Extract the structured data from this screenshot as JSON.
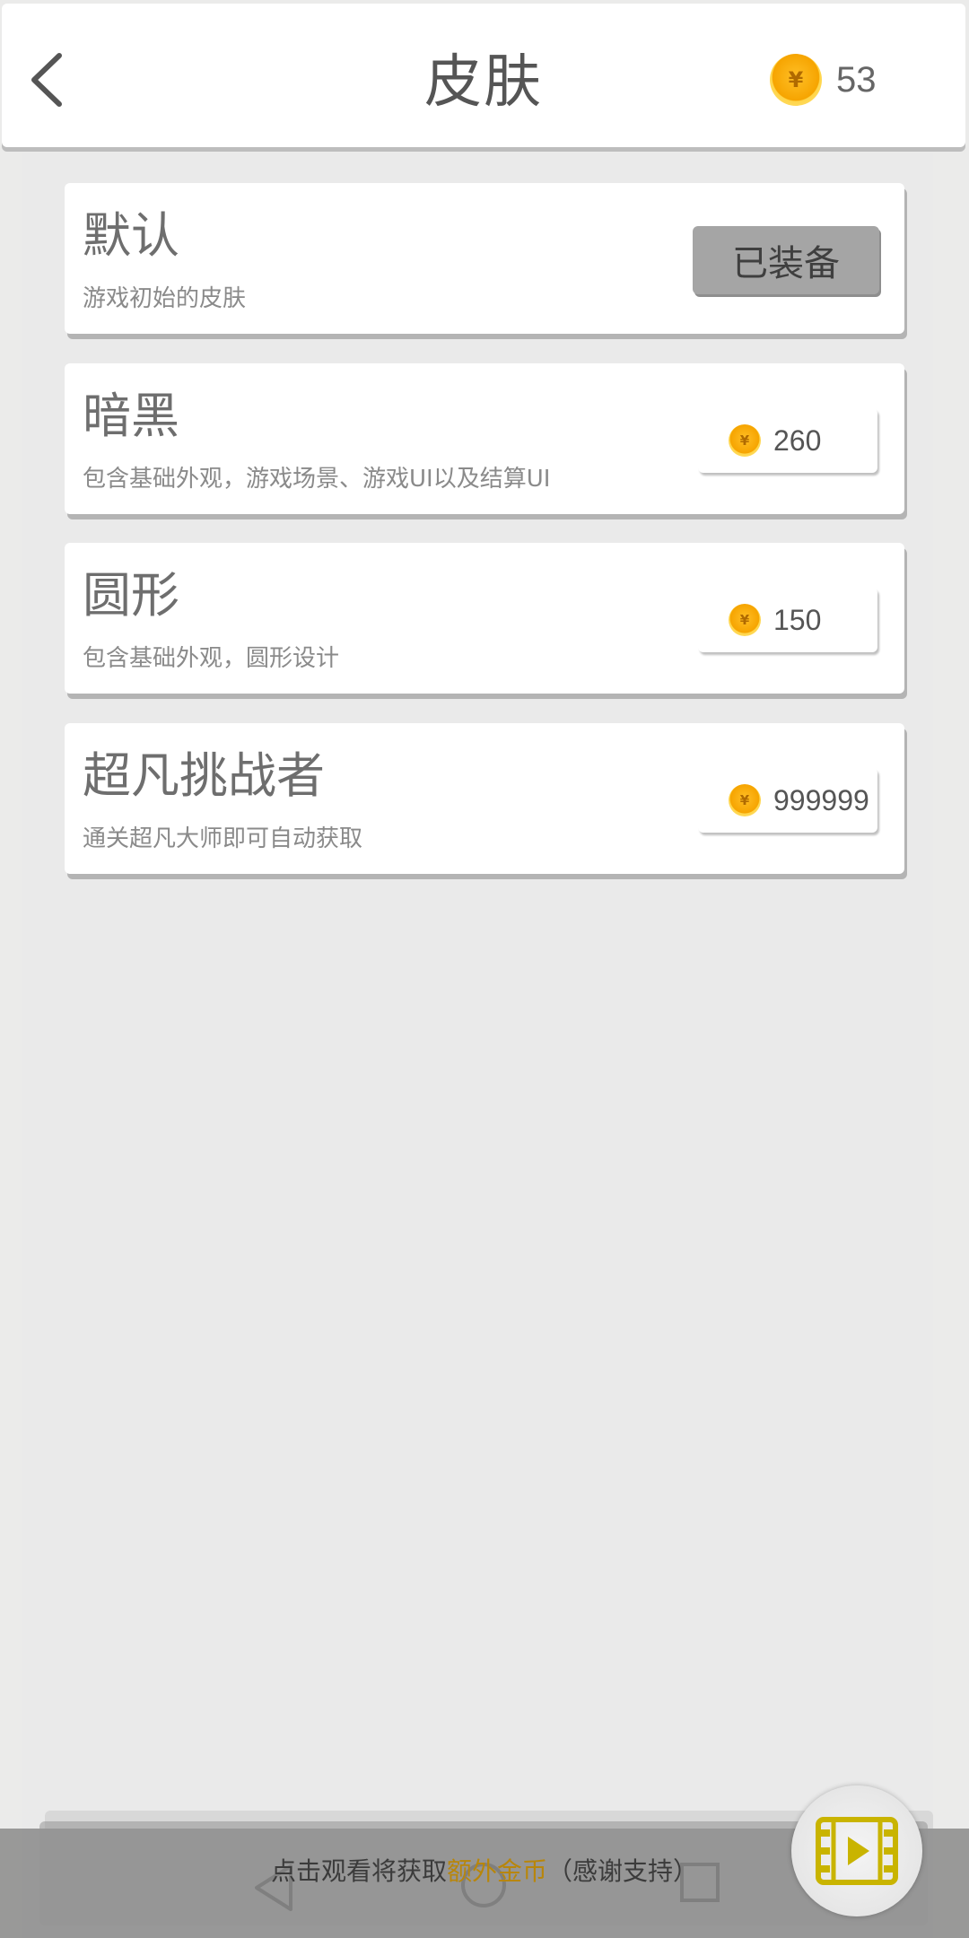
{
  "header": {
    "title": "皮肤",
    "coin_count": "53"
  },
  "skins": [
    {
      "name": "默认",
      "description": "游戏初始的皮肤",
      "status_label": "已装备"
    },
    {
      "name": "暗黑",
      "description": "包含基础外观，游戏场景、游戏UI以及结算UI",
      "price": "260"
    },
    {
      "name": "圆形",
      "description": "包含基础外观，圆形设计",
      "price": "150"
    },
    {
      "name": "超凡挑战者",
      "description": "通关超凡大师即可自动获取",
      "price": "999999"
    }
  ],
  "ad_bar": {
    "text_before": "点击观看将获取",
    "text_highlight": "额外金币",
    "text_after": "（感谢支持）"
  },
  "icons": {
    "back": "chevron-left-icon",
    "coin": "yuan-coin-icon",
    "video": "film-play-icon",
    "coin_symbol": "¥"
  },
  "colors": {
    "coin": "#f6a400",
    "highlight": "#b8860b",
    "equipped_button": "#a5a5a5",
    "film_icon": "#c9b400"
  }
}
